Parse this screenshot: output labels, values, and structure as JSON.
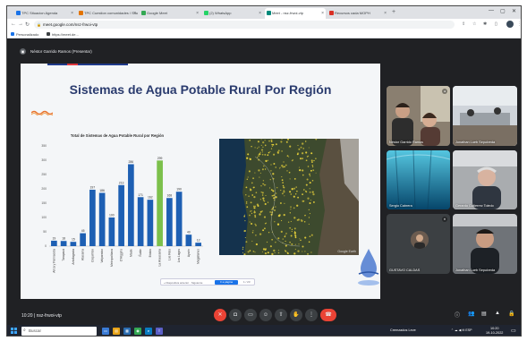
{
  "browser": {
    "tabs": [
      {
        "title": "TPC Situacion Agenda",
        "color": "#1a73e8"
      },
      {
        "title": "TPC Cuestion comunidades / Situacion..",
        "color": "#e37400"
      },
      {
        "title": "Google Meet",
        "color": "#34a853"
      },
      {
        "title": "(2) WhatsApp",
        "color": "#25d366"
      },
      {
        "title": "Meet - nsz-frwoi-vtp",
        "color": "#00897b"
      },
      {
        "title": "Recursos cada MOPH",
        "color": "#d93025"
      }
    ],
    "new_tab_glyph": "+",
    "window_controls": [
      "—",
      "▢",
      "✕"
    ],
    "url": "meet.google.com/nsz-frwoi-vtp",
    "bookmarks": [
      {
        "label": "Personalizado",
        "color": "#1a73e8"
      },
      {
        "label": "https://meet.de...",
        "color": "#3c4043"
      }
    ]
  },
  "meet": {
    "presenter": "Néstor Garrido Ramos (Presentar)",
    "meeting_code": "nsz-frwoi-vtp",
    "time": "10:20",
    "separator": "|",
    "participants": [
      {
        "name": "Néstor Garrido Ramos",
        "photo": "duo",
        "icon": "mic-icon"
      },
      {
        "name": "Jonathan Lueb Sepulveda",
        "photo": "office"
      },
      {
        "name": "Sergio Cabrera",
        "photo": "underwater"
      },
      {
        "name": "Gerardo Gutierrez Toledo",
        "photo": "man"
      },
      {
        "name": "GUSTAVO CALDAS",
        "photo": "avatar",
        "icon": "mic-off-icon"
      },
      {
        "name": "Jonathan Lueb Sepulveda",
        "photo": "room"
      }
    ],
    "controls": [
      "mic-off-icon",
      "camera-icon",
      "captions-icon",
      "emoji-icon",
      "present-icon",
      "hand-icon",
      "more-icon",
      "hangup-icon"
    ],
    "right_controls": [
      "info-icon",
      "people-icon",
      "chat-icon",
      "activities-icon",
      "lock-icon"
    ]
  },
  "slide": {
    "title": "Sistemas de Agua Potable Rural Por Región",
    "map_credit": "Google Earth",
    "nav": {
      "left": "« Diapositiva anterior  ·  Siguiente",
      "highlight": "Ir a página",
      "zoom": "1 / 23"
    }
  },
  "chart_data": {
    "type": "bar",
    "title": "Total de Sistemas de Agua Potable Rural por Región",
    "categories": [
      "Arica y Parinacota",
      "Tarapacá",
      "Antofagasta",
      "Atacama",
      "Coquimbo",
      "Valparaíso",
      "Metropolitana",
      "O'Higgins",
      "Maule",
      "Ñuble",
      "Biobío",
      "La Araucanía",
      "Los Ríos",
      "Los Lagos",
      "Aysén",
      "Magallanes"
    ],
    "values": [
      19,
      18,
      15,
      45,
      197,
      186,
      100,
      213,
      286,
      171,
      162,
      299,
      168,
      190,
      40,
      12
    ],
    "colors": [
      "#1d5fb3",
      "#1d5fb3",
      "#1d5fb3",
      "#1d5fb3",
      "#1d5fb3",
      "#1d5fb3",
      "#1d5fb3",
      "#1d5fb3",
      "#1d5fb3",
      "#1d5fb3",
      "#1d5fb3",
      "#7cc04b",
      "#1d5fb3",
      "#1d5fb3",
      "#1d5fb3",
      "#1d5fb3"
    ],
    "ylim": [
      0,
      350
    ],
    "yticks": [
      0,
      50,
      100,
      150,
      200,
      250,
      300,
      350
    ],
    "xlabel": "",
    "ylabel": "",
    "grid": false
  },
  "taskbar": {
    "search_placeholder": "Buscar",
    "apps": [
      {
        "name": "task-view-icon",
        "color": "#3a7bd5",
        "glyph": "▭"
      },
      {
        "name": "explorer-icon",
        "color": "#e8a317",
        "glyph": "▤"
      },
      {
        "name": "store-icon",
        "color": "#2b6cb0",
        "glyph": "▦"
      },
      {
        "name": "chrome-icon",
        "color": "#34a853",
        "glyph": "◉"
      },
      {
        "name": "edge-icon",
        "color": "#0a7cc1",
        "glyph": "e"
      },
      {
        "name": "teams-icon",
        "color": "#5b5fc7",
        "glyph": "T"
      }
    ],
    "weather": "Cremzados Leve",
    "tray": "⌃ ☁ ◀ ✉ ESP",
    "clock_time": "10:20",
    "clock_date": "19-10-2022"
  }
}
